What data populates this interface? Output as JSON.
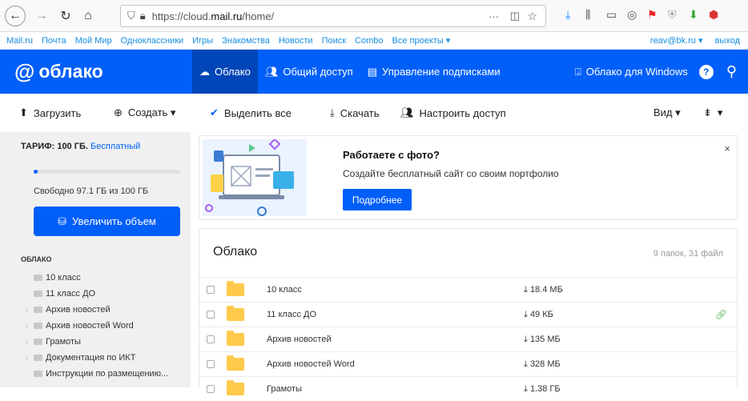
{
  "browser": {
    "url_prefix": "https://cloud.",
    "url_domain": "mail.ru",
    "url_path": "/home/",
    "menu_dots": "···"
  },
  "portal": {
    "links": [
      "Mail.ru",
      "Почта",
      "Мой Мир",
      "Одноклассники",
      "Игры",
      "Знакомства",
      "Новости",
      "Поиск",
      "Combo",
      "Все проекты ▾"
    ],
    "user": "reav@bk.ru ▾",
    "logout": "выход"
  },
  "header": {
    "logo": "облако",
    "nav": [
      "Облако",
      "Общий доступ",
      "Управление подписками"
    ],
    "windows": "Облако для Windows",
    "help": "?",
    "accent": "#005ff9"
  },
  "toolbar": {
    "upload": "Загрузить",
    "create": "Создать ▾",
    "select_all": "Выделить все",
    "download": "Скачать",
    "share": "Настроить доступ",
    "view": "Вид ▾",
    "sort": "▾"
  },
  "sidebar": {
    "tariff_label": "ТАРИФ: 100 ГБ.",
    "tariff_plan": "Бесплатный",
    "used_fraction": 0.029,
    "free_text": "Свободно 97.1 ГБ из 100 ГБ",
    "enlarge_button": "Увеличить объем",
    "section": "ОБЛАКО",
    "tree": [
      {
        "label": "10 класс",
        "expandable": false
      },
      {
        "label": "11 класс ДО",
        "expandable": false
      },
      {
        "label": "Архив новостей",
        "expandable": true
      },
      {
        "label": "Архив новостей Word",
        "expandable": true
      },
      {
        "label": "Грамоты",
        "expandable": true
      },
      {
        "label": "Документация по ИКТ",
        "expandable": true
      },
      {
        "label": "Инструкции по размещению...",
        "expandable": false
      }
    ]
  },
  "promo": {
    "title": "Работаете с фото?",
    "description": "Создайте бесплатный сайт со своим портфолио",
    "button": "Подробнее",
    "close": "×"
  },
  "files": {
    "title": "Облако",
    "count": "9 папок, 31 файл",
    "rows": [
      {
        "name": "10 класс",
        "size": "18.4 МБ",
        "shared": false
      },
      {
        "name": "11 класс ДО",
        "size": "49 КБ",
        "shared": true
      },
      {
        "name": "Архив новостей",
        "size": "135 МБ",
        "shared": false
      },
      {
        "name": "Архив новостей Word",
        "size": "328 МБ",
        "shared": false
      },
      {
        "name": "Грамоты",
        "size": "1.38 ГБ",
        "shared": false
      }
    ]
  }
}
